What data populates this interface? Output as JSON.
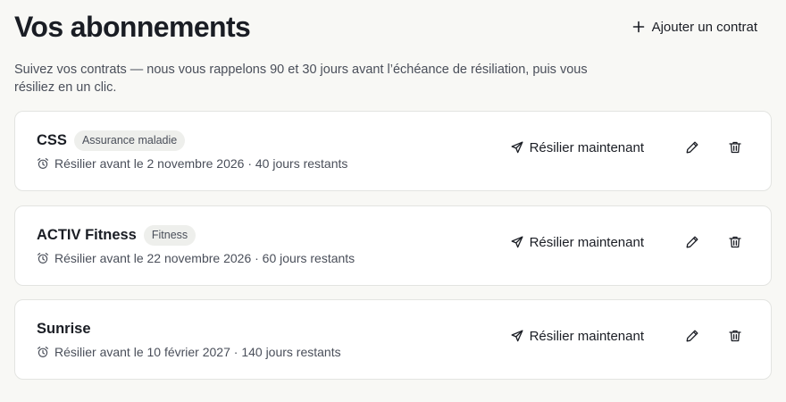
{
  "header": {
    "title": "Vos abonnements",
    "add_label": "Ajouter un contrat"
  },
  "subtitle": "Suivez vos contrats — nous vous rappelons 90 et 30 jours avant l’échéance de résiliation, puis vous résiliez en un clic.",
  "contracts": [
    {
      "name": "CSS",
      "category": "Assurance maladie",
      "deadline": "Résilier avant le 2 novembre 2026 · 40 jours restants",
      "cancel_label": "Résilier maintenant"
    },
    {
      "name": "ACTIV Fitness",
      "category": "Fitness",
      "deadline": "Résilier avant le 22 novembre 2026 · 60 jours restants",
      "cancel_label": "Résilier maintenant"
    },
    {
      "name": "Sunrise",
      "category": "",
      "deadline": "Résilier avant le 10 février 2027 · 140 jours restants",
      "cancel_label": "Résilier maintenant"
    }
  ],
  "icons": {
    "add": "plus-icon",
    "alarm": "alarm-clock-icon",
    "send": "send-icon",
    "edit": "pencil-icon",
    "delete": "trash-icon"
  },
  "colors": {
    "background": "#f8f8f5",
    "card": "#ffffff",
    "text": "#1a1d24",
    "muted": "#4a4f5a",
    "badge": "#eeefec"
  }
}
